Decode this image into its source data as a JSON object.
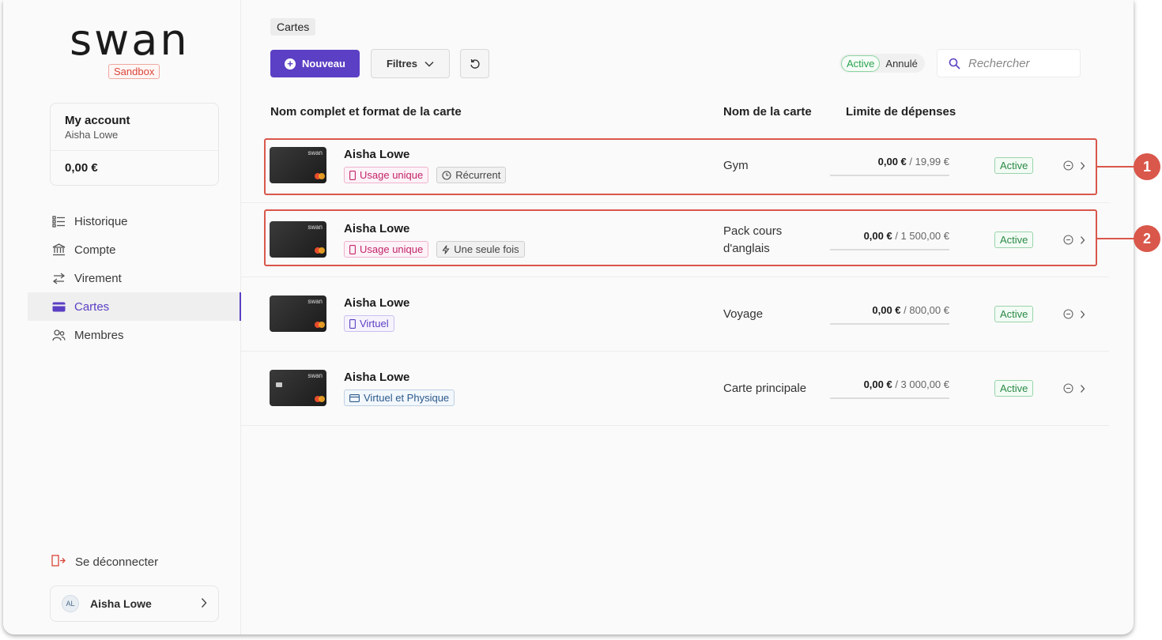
{
  "sidebar": {
    "logo": "swan",
    "env_badge": "Sandbox",
    "account": {
      "title": "My account",
      "holder": "Aisha Lowe",
      "balance": "0,00 €"
    },
    "items": [
      {
        "label": "Historique",
        "icon": "list-icon"
      },
      {
        "label": "Compte",
        "icon": "bank-icon"
      },
      {
        "label": "Virement",
        "icon": "transfer-icon"
      },
      {
        "label": "Cartes",
        "icon": "card-icon"
      },
      {
        "label": "Membres",
        "icon": "members-icon"
      }
    ],
    "active_item": "Cartes",
    "logout_label": "Se déconnecter",
    "user": {
      "initials": "AL",
      "name": "Aisha Lowe"
    }
  },
  "main": {
    "breadcrumb": "Cartes",
    "new_button": "Nouveau",
    "filter_button": "Filtres",
    "status_toggle": {
      "active": "Active",
      "cancelled": "Annulé"
    },
    "search_placeholder": "Rechercher",
    "columns": [
      "Nom complet et format de la carte",
      "Nom de la carte",
      "Limite de dépenses"
    ],
    "rows": [
      {
        "holder": "Aisha Lowe",
        "tags": [
          {
            "label": "Usage unique",
            "icon": "phone-icon"
          },
          {
            "label": "Récurrent",
            "icon": "clock-icon"
          }
        ],
        "card_name": "Gym",
        "spent": "0,00 €",
        "limit": " / 19,99 €",
        "status": "Active",
        "spent_fraction": 0
      },
      {
        "holder": "Aisha Lowe",
        "tags": [
          {
            "label": "Usage unique",
            "icon": "phone-icon"
          },
          {
            "label": "Une seule fois",
            "icon": "flash-icon"
          }
        ],
        "card_name": "Pack cours d'anglais",
        "spent": "0,00 €",
        "limit": " / 1 500,00 €",
        "status": "Active",
        "spent_fraction": 0
      },
      {
        "holder": "Aisha Lowe",
        "tags": [
          {
            "label": "Virtuel",
            "icon": "phone-icon"
          }
        ],
        "card_name": "Voyage",
        "spent": "0,00 €",
        "limit": " / 800,00 €",
        "status": "Active",
        "spent_fraction": 0
      },
      {
        "holder": "Aisha Lowe",
        "tags": [
          {
            "label": "Virtuel et Physique",
            "icon": "card-icon"
          }
        ],
        "card_name": "Carte principale",
        "spent": "0,00 €",
        "limit": " / 3 000,00 €",
        "status": "Active",
        "spent_fraction": 0
      }
    ],
    "card_brand": "swan"
  },
  "callouts": [
    "1",
    "2"
  ],
  "colors": {
    "accent": "#5b3fc4",
    "callout": "#d9574b",
    "active_green": "#2a8a45"
  }
}
